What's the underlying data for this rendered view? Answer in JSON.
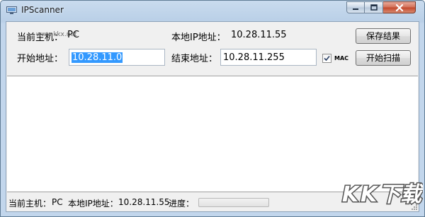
{
  "window": {
    "title": "IPScanner"
  },
  "form": {
    "current_host_label": "当前主机：",
    "current_host_value": "PC",
    "local_ip_label": "本地IP地址：",
    "local_ip_value": "10.28.11.55",
    "start_label": "开始地址：",
    "start_value": "10.28.11.0",
    "end_label": "结束地址：",
    "end_value": "10.28.11.255",
    "mac_label": "MAC",
    "mac_checked": true,
    "save_button": "保存结果",
    "scan_button": "开始扫描"
  },
  "status": {
    "host_label": "当前主机：",
    "host_value": "PC",
    "ip_label": "本地IP地址：",
    "ip_value": "10.28.11.55",
    "progress_label": "进度：",
    "progress": 0
  },
  "watermark": {
    "brand": "KK下载",
    "site": "www.kkx.net"
  }
}
